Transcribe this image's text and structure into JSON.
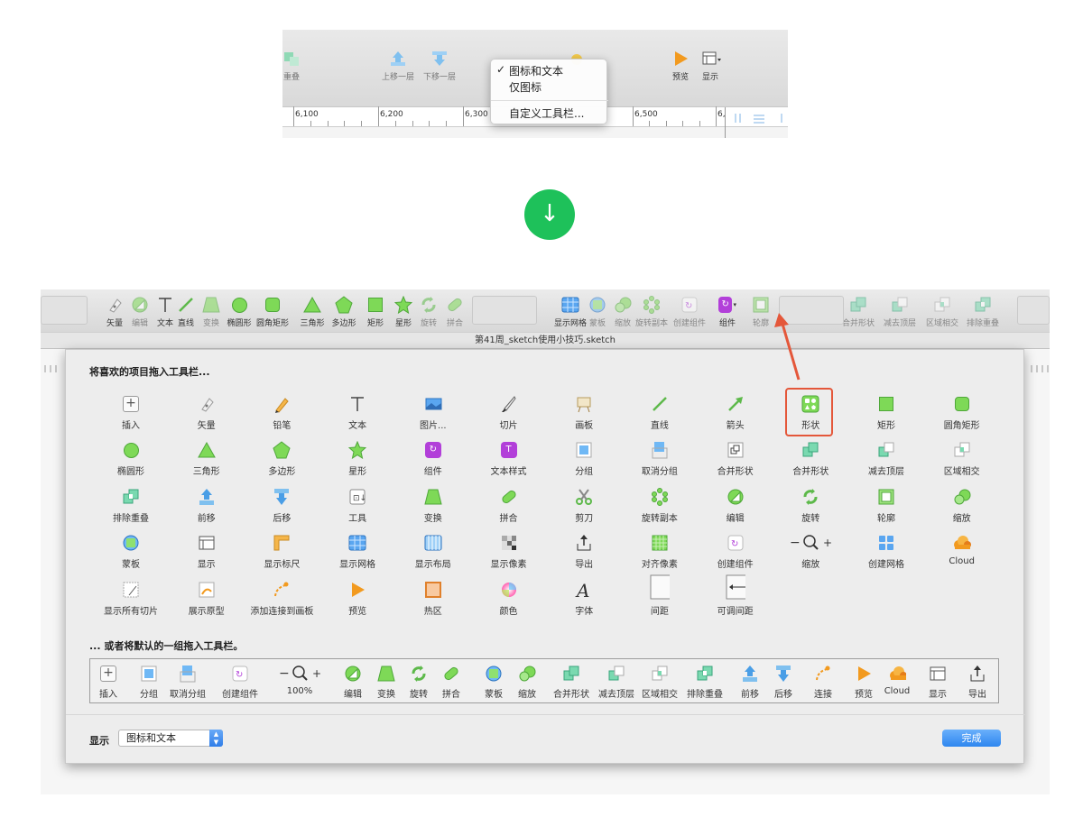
{
  "top_snippet": {
    "toolbar_items": [
      "重叠",
      "上移一层",
      "下移一层",
      "预览",
      "显示"
    ],
    "ruler_labels": [
      "6,100",
      "6,200",
      "6,300",
      "6,500",
      "6,"
    ],
    "menu": {
      "items": [
        "图标和文本",
        "仅图标",
        "自定义工具栏..."
      ],
      "checked": "图标和文本"
    }
  },
  "arrow_symbol": "↓",
  "window": {
    "title": "第41周_sketch使用小技巧.sketch",
    "toolbar": [
      "矢量",
      "编辑",
      "文本",
      "直线",
      "变换",
      "椭圆形",
      "圆角矩形",
      "三角形",
      "多边形",
      "矩形",
      "星形",
      "旋转",
      "拼合",
      "显示网格",
      "蒙板",
      "缩放",
      "旋转副本",
      "创建组件",
      "组件",
      "轮廓",
      "合并形状",
      "减去顶层",
      "区域相交",
      "排除重叠"
    ]
  },
  "sheet": {
    "drag_heading": "将喜欢的项目拖入工具栏...",
    "grid": [
      [
        "插入",
        "矢量",
        "铅笔",
        "文本",
        "图片...",
        "切片",
        "画板",
        "直线",
        "箭头",
        "形状",
        "矩形",
        "圆角矩形"
      ],
      [
        "椭圆形",
        "三角形",
        "多边形",
        "星形",
        "组件",
        "文本样式",
        "分组",
        "取消分组",
        "合并形状",
        "合并形状",
        "减去顶层",
        "区域相交"
      ],
      [
        "排除重叠",
        "前移",
        "后移",
        "工具",
        "变换",
        "拼合",
        "剪刀",
        "旋转副本",
        "编辑",
        "旋转",
        "轮廓",
        "缩放"
      ],
      [
        "蒙板",
        "显示",
        "显示标尺",
        "显示网格",
        "显示布局",
        "显示像素",
        "导出",
        "对齐像素",
        "创建组件",
        "缩放",
        "创建网格",
        "Cloud"
      ],
      [
        "显示所有切片",
        "展示原型",
        "添加连接到画板",
        "预览",
        "热区",
        "颜色",
        "字体",
        "间距",
        "可调间距"
      ]
    ],
    "default_heading": "... 或者将默认的一组拖入工具栏。",
    "default_set": [
      "插入",
      "分组",
      "取消分组",
      "创建组件",
      "100%",
      "编辑",
      "变换",
      "旋转",
      "拼合",
      "蒙板",
      "缩放",
      "合并形状",
      "减去顶层",
      "区域相交",
      "排除重叠",
      "前移",
      "后移",
      "连接",
      "预览",
      "Cloud",
      "显示",
      "导出"
    ],
    "show_label": "显示",
    "show_value": "图标和文本",
    "done_label": "完成"
  },
  "colors": {
    "accent_green": "#1ec15a",
    "highlight_red": "#e4573a",
    "button_blue": "#2e86ef",
    "shape_green": "#7ed957",
    "component_purple": "#b23fd9"
  }
}
